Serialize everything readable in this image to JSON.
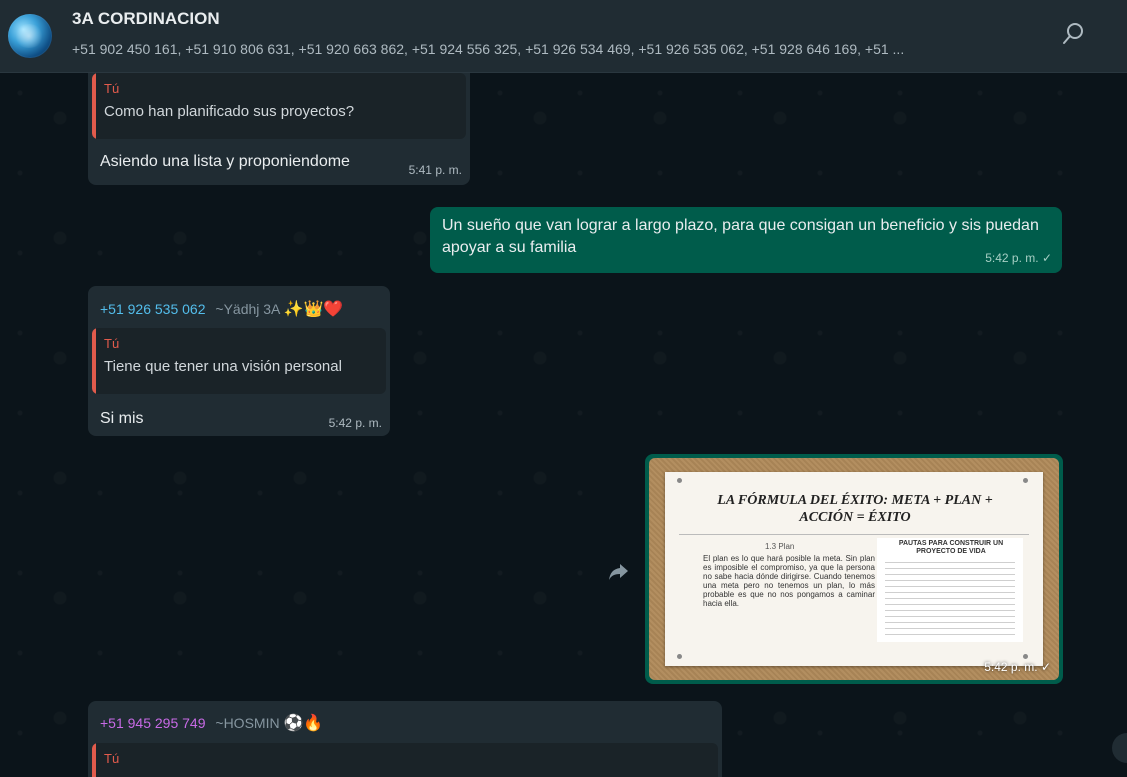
{
  "header": {
    "title": "3A CORDINACION",
    "members": "+51 902 450 161, +51 910 806 631, +51 920 663 862, +51 924 556 325, +51 926 534 469, +51 926 535 062, +51 928 646 169, +51 ..."
  },
  "messages": [
    {
      "reply_author": "Tú",
      "reply_text": "Como han planificado sus proyectos?",
      "text": "Asiendo una lista y proponiendome",
      "time": "5:41 p. m."
    },
    {
      "text": "Un sueño que van lograr a largo plazo, para que consigan un beneficio y sis puedan apoyar a su familia",
      "time": "5:42 p. m.",
      "status": "✓"
    },
    {
      "sender_phone": "+51 926 535 062",
      "sender_alias": "~Yädhj 3A",
      "sender_emojis": "✨👑❤️",
      "reply_author": "Tú",
      "reply_text": "Tiene que tener una visión personal",
      "text": "Si mis",
      "time": "5:42 p. m."
    },
    {
      "image": {
        "title": "LA FÓRMULA DEL ÉXITO: META + PLAN + ACCIÓN = ÉXITO",
        "section": "1.3 Plan",
        "body": "El plan es lo que hará posible la meta. Sin plan es imposible el compromiso, ya que la persona no sabe hacia dónde dirigirse. Cuando tenemos una meta pero no tenemos un plan, lo más probable es que no nos pongamos a caminar hacia ella.",
        "right_title": "PAUTAS PARA CONSTRUIR UN PROYECTO DE VIDA"
      },
      "time": "5:42 p. m.",
      "status": "✓"
    },
    {
      "sender_phone": "+51 945 295 749",
      "sender_alias": "~HOSMIN",
      "sender_emojis": "⚽🔥",
      "reply_author": "Tú"
    }
  ]
}
